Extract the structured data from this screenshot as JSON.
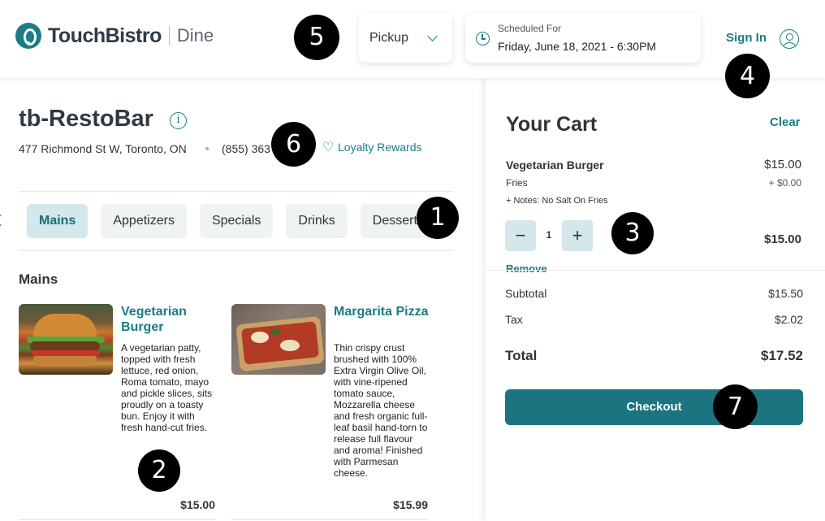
{
  "header": {
    "brand": "TouchBistro",
    "brand_sub": "Dine",
    "order_type": "Pickup",
    "schedule_label": "Scheduled For",
    "schedule_value": "Friday, June 18, 2021 - 6:30PM",
    "sign_in": "Sign In"
  },
  "restaurant": {
    "name": "tb-RestoBar",
    "info_glyph": "i",
    "address": "477 Richmond St W, Toronto, ON",
    "phone": "(855) 363",
    "loyalty": "Loyalty Rewards"
  },
  "tabs": [
    {
      "label": "Mains",
      "active": true
    },
    {
      "label": "Appetizers"
    },
    {
      "label": "Specials"
    },
    {
      "label": "Drinks"
    },
    {
      "label": "Desserts"
    }
  ],
  "menu": {
    "section_title": "Mains",
    "items": [
      {
        "name": "Vegetarian Burger",
        "description": "A vegetarian patty, topped with fresh lettuce, red onion, Roma tomato, mayo and pickle slices, sits proudly on a toasty bun. Enjoy it with fresh hand-cut fries.",
        "price": "$15.00"
      },
      {
        "name": "Margarita Pizza",
        "description": "Thin crispy crust brushed with 100% Extra Virgin Olive Oil, with vine-ripened tomato sauce, Mozzarella cheese and fresh organic full-leaf basil hand-torn to release full flavour and aroma! Finished with Parmesan cheese.",
        "price": "$15.99"
      }
    ]
  },
  "cart": {
    "title": "Your Cart",
    "clear": "Clear",
    "item": {
      "name": "Vegetarian Burger",
      "price": "$15.00",
      "modifier": "Fries",
      "modifier_price": "+ $0.00",
      "notes": "+ Notes: No Salt On Fries",
      "quantity": "1",
      "minus": "−",
      "plus": "+",
      "line_total": "$15.00",
      "remove": "Remove"
    },
    "subtotal_label": "Subtotal",
    "subtotal": "$15.50",
    "tax_label": "Tax",
    "tax": "$2.02",
    "total_label": "Total",
    "total": "$17.52",
    "checkout": "Checkout"
  },
  "markers": [
    "1",
    "2",
    "3",
    "4",
    "5",
    "6",
    "7"
  ],
  "colors": {
    "accent": "#1b7c86",
    "checkout_bg": "#1b7480",
    "tab_active_bg": "#d4e7ea"
  }
}
